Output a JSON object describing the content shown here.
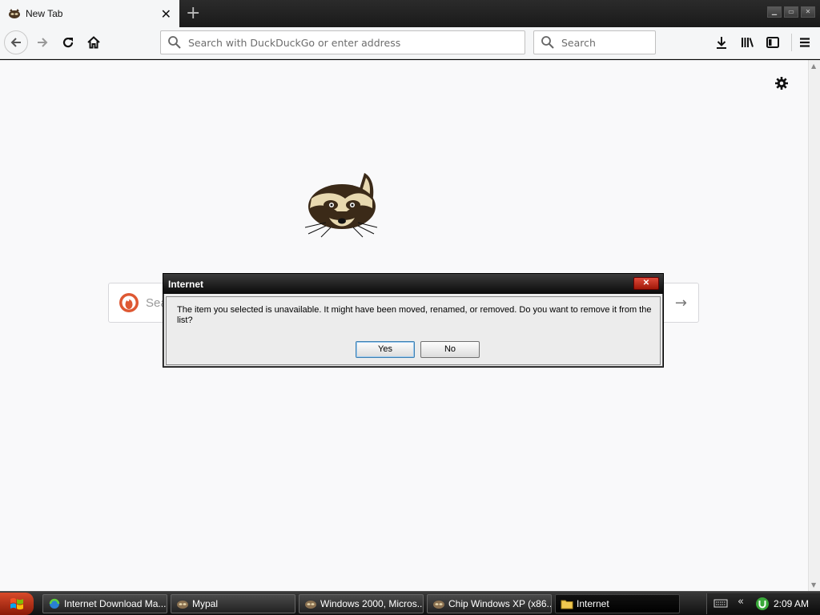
{
  "browser": {
    "tab": {
      "title": "New Tab",
      "close_icon": "close-icon"
    },
    "new_tab_icon": "plus-icon",
    "window_controls": [
      "minimize-icon",
      "maximize-icon",
      "close-icon"
    ],
    "nav": {
      "back_icon": "arrow-left-icon",
      "forward_icon": "arrow-right-icon",
      "reload_icon": "reload-icon",
      "home_icon": "home-icon"
    },
    "urlbar": {
      "placeholder": "Search with DuckDuckGo or enter address"
    },
    "searchbar": {
      "placeholder": "Search"
    },
    "toolbar_icons": [
      "download-icon",
      "library-icon",
      "sidebar-icon",
      "menu-icon"
    ]
  },
  "newtab_page": {
    "settings_icon": "gear-icon",
    "logo": "raccoon-logo",
    "search_box": {
      "text": "Sea",
      "go_icon": "arrow-right-icon"
    }
  },
  "dialog": {
    "title": "Internet",
    "message": "The item you selected is unavailable.  It might have been moved, renamed, or removed.  Do you want to remove it from the list?",
    "buttons": {
      "yes": "Yes",
      "no": "No"
    }
  },
  "taskbar": {
    "tasks": [
      {
        "label": "Internet Download Ma...",
        "icon": "idm-icon",
        "active": false
      },
      {
        "label": "Mypal",
        "icon": "raccoon-icon",
        "active": false
      },
      {
        "label": "Windows 2000, Micros...",
        "icon": "raccoon-icon",
        "active": false
      },
      {
        "label": "Chip Windows XP (x86...",
        "icon": "raccoon-icon",
        "active": false
      },
      {
        "label": "Internet",
        "icon": "folder-icon",
        "active": true
      }
    ],
    "clock": "2:09 AM"
  },
  "colors": {
    "accent": "#3c7fb1",
    "dialog_close": "#c8301e",
    "start_button": "#c43a1c"
  }
}
